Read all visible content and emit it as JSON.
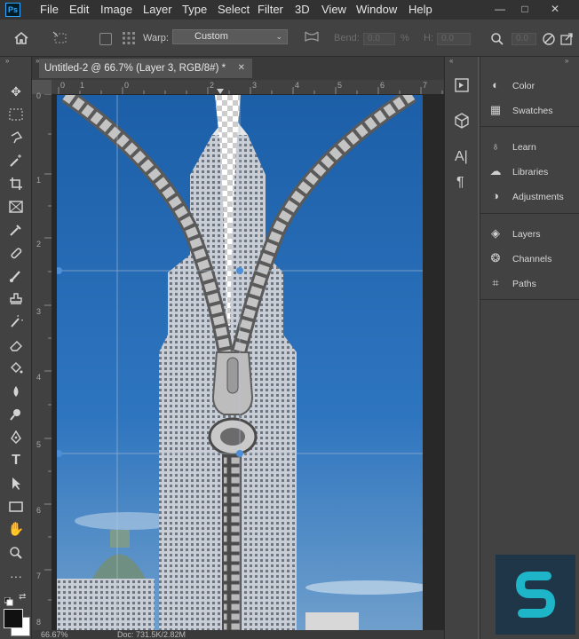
{
  "app": {
    "logo_text": "Ps"
  },
  "menu": [
    "File",
    "Edit",
    "Image",
    "Layer",
    "Type",
    "Select",
    "Filter",
    "3D",
    "View",
    "Window",
    "Help"
  ],
  "window_controls": {
    "minimize": "—",
    "restore": "□",
    "close": "✕"
  },
  "options_bar": {
    "warp_label": "Warp:",
    "warp_value": "Custom",
    "bend_label": "Bend:",
    "bend_value": "0.0",
    "bend_unit": "%",
    "h_label": "H:",
    "h_value": "0.0",
    "v_value": "0.0"
  },
  "document": {
    "tab_title": "Untitled-2 @ 66.7% (Layer 3, RGB/8#) *",
    "close_glyph": "✕"
  },
  "rulers": {
    "horizontal": [
      "0",
      "1",
      "0",
      "2",
      "3",
      "4",
      "5",
      "6",
      "7"
    ],
    "vertical": [
      "0",
      "1",
      "2",
      "3",
      "4",
      "5",
      "6",
      "7",
      "8"
    ]
  },
  "panels": {
    "group1": [
      {
        "label": "Color",
        "icon": "color-palette-icon"
      },
      {
        "label": "Swatches",
        "icon": "swatches-grid-icon"
      }
    ],
    "group2": [
      {
        "label": "Learn",
        "icon": "lightbulb-icon"
      },
      {
        "label": "Libraries",
        "icon": "libraries-cloud-icon"
      },
      {
        "label": "Adjustments",
        "icon": "adjustments-circle-icon"
      }
    ],
    "group3": [
      {
        "label": "Layers",
        "icon": "layers-stack-icon"
      },
      {
        "label": "Channels",
        "icon": "channels-circles-icon"
      },
      {
        "label": "Paths",
        "icon": "paths-pen-icon"
      }
    ]
  },
  "status_bar": {
    "zoom": "66.67%",
    "doc_info": "Doc: 731.5K/2.82M"
  },
  "colors": {
    "accent": "#31a8ff",
    "sky": "#2b6bb0",
    "brand": "#1e3648",
    "brand_mark": "#1fb5c9"
  }
}
